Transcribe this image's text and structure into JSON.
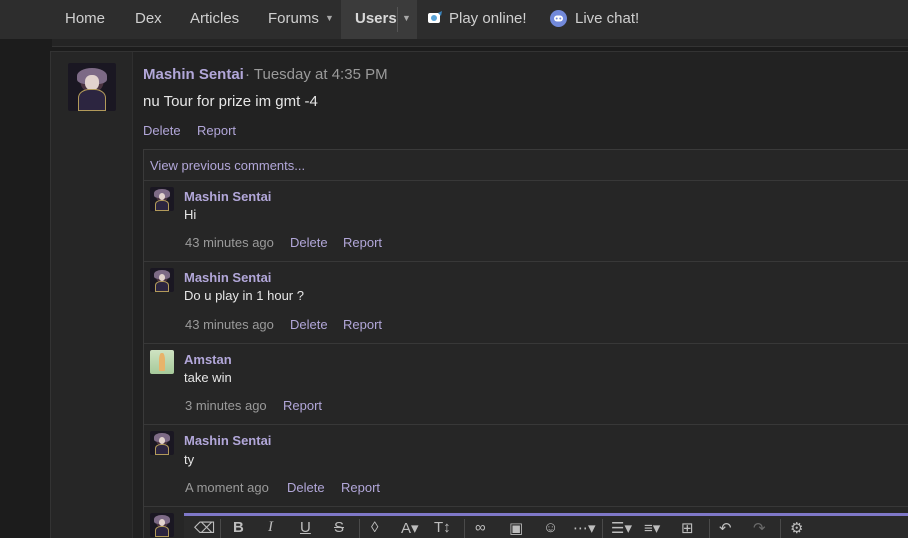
{
  "nav": {
    "home": "Home",
    "dex": "Dex",
    "articles": "Articles",
    "forums": "Forums",
    "users": "Users",
    "play_online": "Play online!",
    "live_chat": "Live chat!"
  },
  "post": {
    "author": "Mashin Sentai",
    "time": "· Tuesday at 4:35 PM",
    "body": "nu Tour for prize im gmt -4",
    "delete": "Delete",
    "report": "Report"
  },
  "comments": {
    "view_previous": "View previous comments...",
    "items": [
      {
        "author": "Mashin Sentai",
        "text": "Hi",
        "time": "43 minutes ago",
        "delete": "Delete",
        "report": "Report"
      },
      {
        "author": "Mashin Sentai",
        "text": "Do u play in 1 hour ?",
        "time": "43 minutes ago",
        "delete": "Delete",
        "report": "Report"
      },
      {
        "author": "Amstan",
        "text": "take win",
        "time": "3 minutes ago",
        "report": "Report"
      },
      {
        "author": "Mashin Sentai",
        "text": "ty",
        "time": "A moment ago",
        "delete": "Delete",
        "report": "Report"
      }
    ]
  },
  "toolbar_icons": [
    "eraser-icon",
    "bold-icon",
    "italic-icon",
    "underline-icon",
    "strike-icon",
    "ink-drop-icon",
    "font-color-icon",
    "font-size-icon",
    "link-icon",
    "image-icon",
    "smiley-icon",
    "more-icon",
    "align-icon",
    "list-icon",
    "table-icon",
    "undo-icon",
    "redo-icon",
    "settings-icon"
  ],
  "colors": {
    "accent": "#b2a7d9",
    "nav_bg": "#2d2d2d",
    "editor_bar": "#7f78c8"
  }
}
